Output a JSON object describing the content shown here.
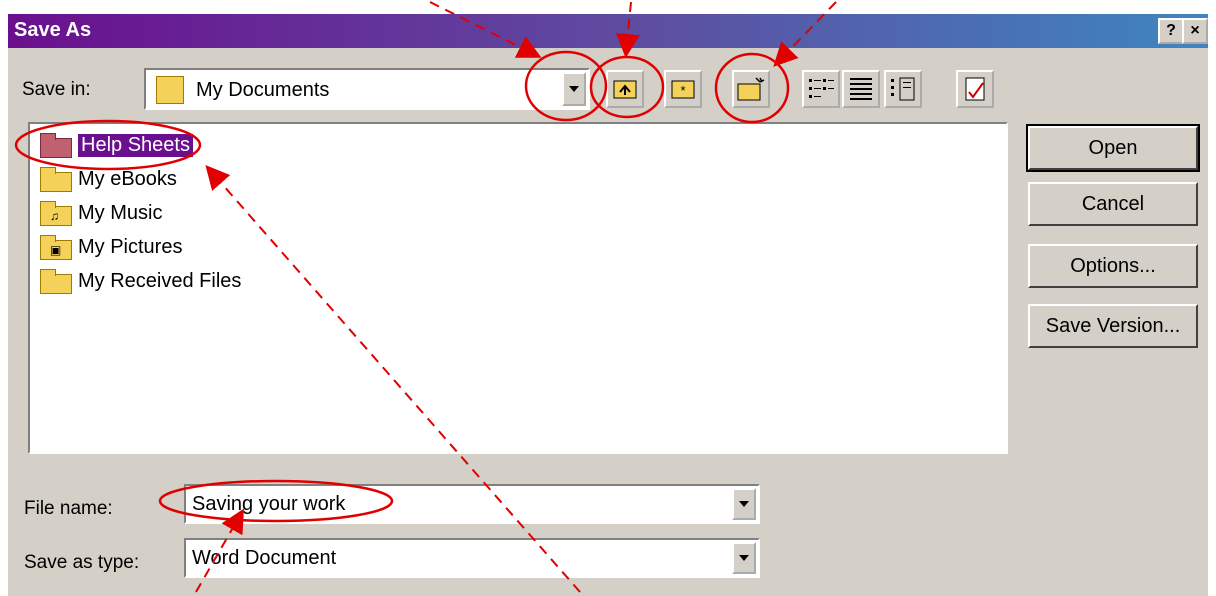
{
  "window": {
    "title": "Save As",
    "help_button": "?",
    "close_button": "×"
  },
  "save_in": {
    "label": "Save in:",
    "value": "My Documents"
  },
  "toolbar": {
    "icons": [
      "up-one-level-icon",
      "search-web-icon",
      "create-new-folder-icon",
      "list-view-icon",
      "details-view-icon",
      "properties-view-icon",
      "tools-icon"
    ]
  },
  "files": [
    {
      "name": "Help Sheets",
      "icon": "folder-icon",
      "selected": true
    },
    {
      "name": "My eBooks",
      "icon": "folder-icon",
      "selected": false
    },
    {
      "name": "My Music",
      "icon": "music-folder-icon",
      "selected": false
    },
    {
      "name": "My Pictures",
      "icon": "pictures-folder-icon",
      "selected": false
    },
    {
      "name": "My Received Files",
      "icon": "folder-icon",
      "selected": false
    }
  ],
  "buttons": {
    "open": "Open",
    "cancel": "Cancel",
    "options": "Options...",
    "save_version": "Save Version..."
  },
  "file_name": {
    "label": "File name:",
    "value": "Saving your work"
  },
  "save_as_type": {
    "label": "Save as type:",
    "value": "Word Document"
  },
  "colors": {
    "annotation": "#e00000",
    "title_gradient_start": "#6a0f8e",
    "title_gradient_end": "#3e86bf",
    "selection": "#6a0f8e"
  }
}
